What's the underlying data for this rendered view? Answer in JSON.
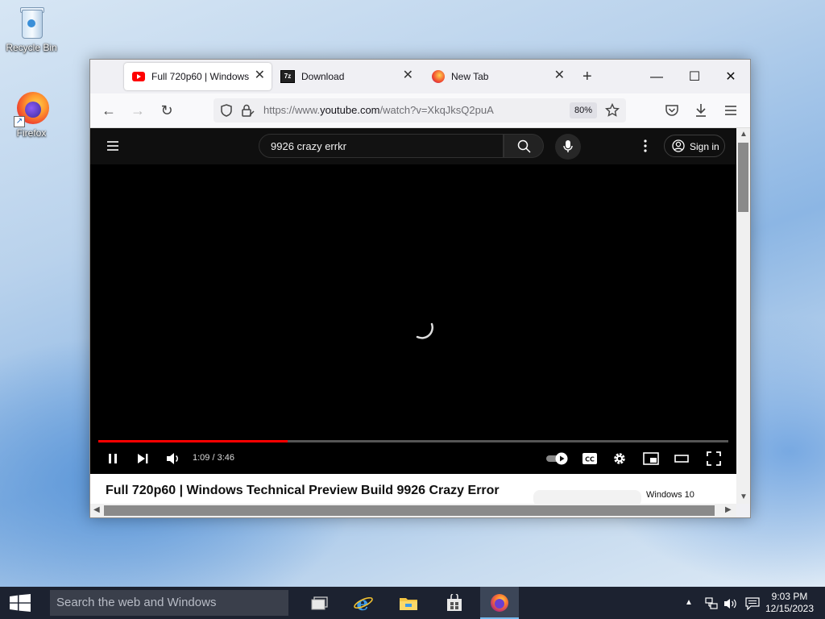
{
  "desktop": {
    "icons": [
      {
        "label": "Recycle Bin",
        "icon": "recycle-bin-icon"
      },
      {
        "label": "Firefox",
        "icon": "firefox-icon"
      }
    ]
  },
  "browser": {
    "tabs": [
      {
        "title": "Full 720p60 | Windows Technical Preview Build 9926 Crazy Error",
        "favicon": "youtube-icon",
        "active": true
      },
      {
        "title": "Download",
        "favicon": "7zip-icon",
        "active": false
      },
      {
        "title": "New Tab",
        "favicon": "firefox-icon",
        "active": false
      }
    ],
    "favicon_text": {
      "sevenzip": "7z"
    },
    "url": {
      "prefix": "https://www.",
      "host": "youtube.com",
      "path": "/watch?v=XkqJksQ2puA"
    },
    "zoom": "80%"
  },
  "youtube": {
    "search_value": "9926 crazy errkr",
    "sign_in": "Sign in",
    "time": "1:09 / 3:46",
    "progress_fraction": 0.3,
    "title": "Full 720p60 | Windows Technical Preview Build 9926 Crazy Error",
    "chip": "Windows 10"
  },
  "taskbar": {
    "search_placeholder": "Search the web and Windows",
    "clock_time": "9:03 PM",
    "clock_date": "12/15/2023"
  },
  "colors": {
    "accent_red": "#ff0000",
    "taskbar": "#1c2230"
  }
}
